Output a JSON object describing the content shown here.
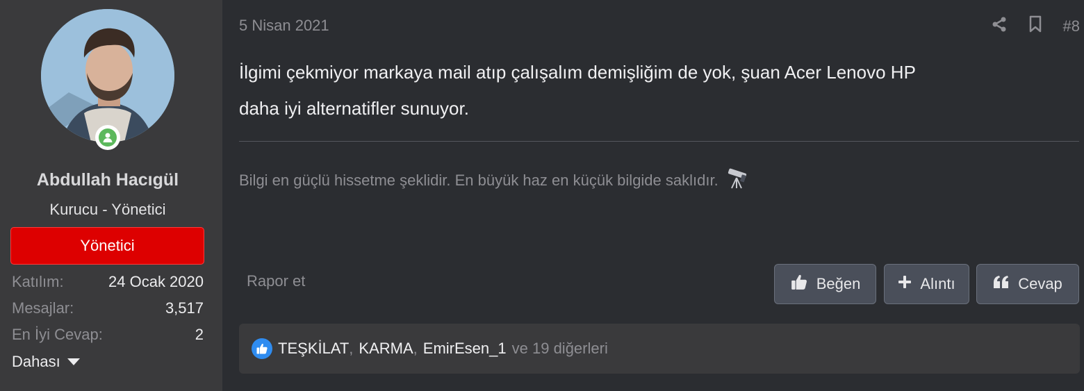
{
  "user": {
    "name": "Abdullah Hacıgül",
    "title": "Kurucu - Yönetici",
    "banner": "Yönetici",
    "stats": [
      {
        "label": "Katılım:",
        "value": "24 Ocak 2020"
      },
      {
        "label": "Mesajlar:",
        "value": "3,517"
      },
      {
        "label": "En İyi Cevap:",
        "value": "2"
      }
    ],
    "more_label": "Dahası",
    "avatar_icon": "user-avatar-photo",
    "status_icon": "online-user-icon",
    "status_color": "#5cb85c",
    "banner_color": "#dd0000"
  },
  "post": {
    "date": "5 Nisan 2021",
    "number": "#8",
    "body_line1": "İlgimi çekmiyor markaya mail atıp çalışalım demişliğim de yok, şuan Acer Lenovo HP",
    "body_line2": "daha iyi alternatifler sunuyor.",
    "signature": "Bilgi en güçlü hissetme şeklidir. En büyük haz en küçük bilgide saklıdır.",
    "signature_emoji": "🔭",
    "share_icon": "share-icon",
    "bookmark_icon": "bookmark-icon"
  },
  "actions": {
    "report": "Rapor et",
    "like": "Beğen",
    "quote": "Alıntı",
    "reply": "Cevap"
  },
  "reactions": {
    "users": [
      "TEŞKİLAT",
      "KARMA",
      "EmirEsen_1"
    ],
    "others": "ve 19 diğerleri",
    "icon": "thumbs-up-reaction-icon",
    "icon_color": "#2f8cf0"
  }
}
